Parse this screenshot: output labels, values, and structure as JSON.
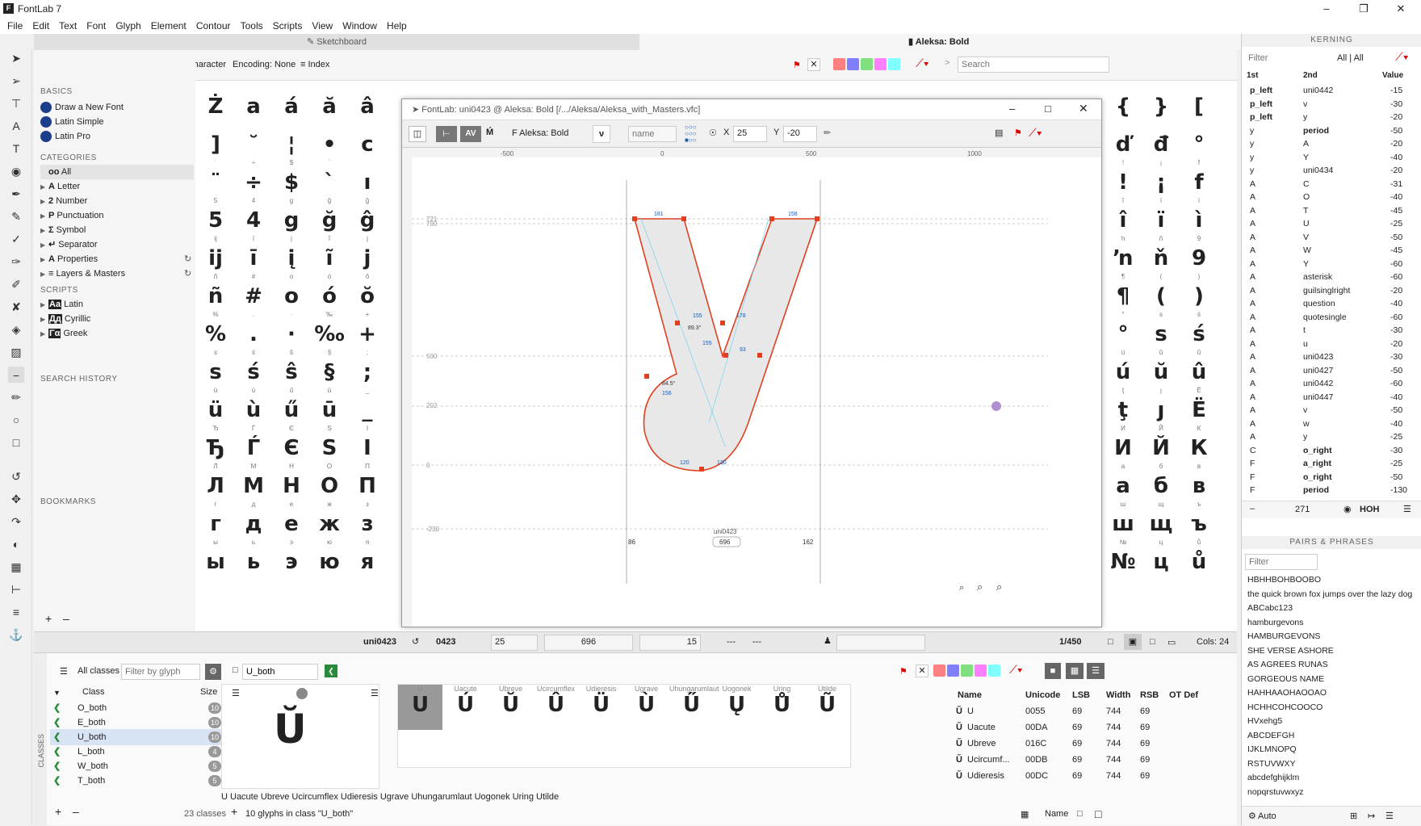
{
  "app": {
    "title": "FontLab 7"
  },
  "menu": [
    "File",
    "Edit",
    "Text",
    "Font",
    "Glyph",
    "Element",
    "Contour",
    "Tools",
    "Scripts",
    "View",
    "Window",
    "Help"
  ],
  "tabs": {
    "sketchboard": "Sketchboard",
    "font": "Aleksa: Bold"
  },
  "toolbar": {
    "character": "Character",
    "encoding": "Encoding: None",
    "index": "Index",
    "search_placeholder": "Search"
  },
  "sidebar": {
    "basics_title": "BASICS",
    "basics": [
      "Draw a New Font",
      "Latin Simple",
      "Latin Pro"
    ],
    "categories_title": "CATEGORIES",
    "categories": [
      "All",
      "Letter",
      "Number",
      "Punctuation",
      "Symbol",
      "Separator",
      "Properties",
      "Layers & Masters"
    ],
    "category_icons": [
      "oo",
      "A",
      "2",
      "P",
      "Σ",
      "↵",
      "A",
      "≡"
    ],
    "scripts_title": "SCRIPTS",
    "scripts": [
      "Latin",
      "Cyrillic",
      "Greek"
    ],
    "script_icons": [
      "Aa",
      "Дд",
      "Γα"
    ],
    "search_history_title": "SEARCH HISTORY",
    "bookmarks_title": "BOOKMARKS"
  },
  "grid_left": [
    [
      [
        "",
        "Ż"
      ],
      [
        "",
        "a"
      ],
      [
        "",
        "á"
      ],
      [
        "",
        "ă"
      ],
      [
        "",
        "â"
      ]
    ],
    [
      [
        "",
        "]"
      ],
      [
        "",
        "˘"
      ],
      [
        "",
        "¦"
      ],
      [
        "",
        "•"
      ],
      [
        "",
        "c"
      ]
    ],
    [
      [
        "˙",
        "¨"
      ],
      [
        "÷",
        "÷"
      ],
      [
        "$",
        "$"
      ],
      [
        "`",
        "`"
      ],
      [
        "",
        "ı"
      ]
    ],
    [
      [
        "5",
        "5"
      ],
      [
        "4",
        "4"
      ],
      [
        "g",
        "g"
      ],
      [
        "ğ",
        "ğ"
      ],
      [
        "ĝ",
        "ĝ"
      ]
    ],
    [
      [
        "ij",
        "ij"
      ],
      [
        "ī",
        "ī"
      ],
      [
        "į",
        "į"
      ],
      [
        "ĩ",
        "ĩ"
      ],
      [
        "j",
        "j"
      ]
    ],
    [
      [
        "ñ",
        "ñ"
      ],
      [
        "#",
        "#"
      ],
      [
        "o",
        "o"
      ],
      [
        "ó",
        "ó"
      ],
      [
        "ŏ",
        "ŏ"
      ]
    ],
    [
      [
        "%",
        "%"
      ],
      [
        ".",
        "."
      ],
      [
        "·",
        "·"
      ],
      [
        "‰",
        "‰"
      ],
      [
        "+",
        "+"
      ]
    ],
    [
      [
        "s",
        "s"
      ],
      [
        "ś",
        "ś"
      ],
      [
        "ŝ",
        "ŝ"
      ],
      [
        "§",
        "§"
      ],
      [
        ";",
        ";"
      ]
    ],
    [
      [
        "ü",
        "ü"
      ],
      [
        "ù",
        "ù"
      ],
      [
        "ű",
        "ű"
      ],
      [
        "ū",
        "ū"
      ],
      [
        "_",
        "_"
      ]
    ],
    [
      [
        "Ђ",
        "Ђ"
      ],
      [
        "Ѓ",
        "Ѓ"
      ],
      [
        "Є",
        "Є"
      ],
      [
        "Ѕ",
        "Ѕ"
      ],
      [
        "І",
        "І"
      ]
    ],
    [
      [
        "Л",
        "Л"
      ],
      [
        "М",
        "М"
      ],
      [
        "Н",
        "Н"
      ],
      [
        "О",
        "О"
      ],
      [
        "П",
        "П"
      ]
    ],
    [
      [
        "г",
        "г"
      ],
      [
        "д",
        "д"
      ],
      [
        "е",
        "е"
      ],
      [
        "ж",
        "ж"
      ],
      [
        "з",
        "з"
      ]
    ],
    [
      [
        "ы",
        "ы"
      ],
      [
        "ь",
        "ь"
      ],
      [
        "э",
        "э"
      ],
      [
        "ю",
        "ю"
      ],
      [
        "я",
        "я"
      ]
    ]
  ],
  "grid_right": [
    [
      [
        "",
        "{"
      ],
      [
        "",
        "}"
      ],
      [
        "",
        "["
      ]
    ],
    [
      [
        "",
        "ď"
      ],
      [
        "",
        "đ"
      ],
      [
        "",
        "°"
      ]
    ],
    [
      [
        "!",
        "!"
      ],
      [
        "¡",
        "¡"
      ],
      [
        "f",
        "f"
      ]
    ],
    [
      [
        "î",
        "î"
      ],
      [
        "ï",
        "ï"
      ],
      [
        "ì",
        "ì"
      ]
    ],
    [
      [
        "ŉ",
        "ŉ"
      ],
      [
        "ň",
        "ň"
      ],
      [
        "9",
        "9"
      ]
    ],
    [
      [
        "¶",
        "¶"
      ],
      [
        "(",
        "("
      ],
      [
        ")",
        ")"
      ]
    ],
    [
      [
        "°",
        "°"
      ],
      [
        "s",
        "s"
      ],
      [
        "ś",
        "ś"
      ]
    ],
    [
      [
        "ú",
        "ú"
      ],
      [
        "ŭ",
        "ŭ"
      ],
      [
        "û",
        "û"
      ]
    ],
    [
      [
        "ţ",
        "ţ"
      ],
      [
        "ȷ",
        "ȷ"
      ],
      [
        "Ë",
        "Ë"
      ]
    ],
    [
      [
        "И",
        "И"
      ],
      [
        "Й",
        "Й"
      ],
      [
        "К",
        "К"
      ]
    ],
    [
      [
        "а",
        "а"
      ],
      [
        "б",
        "б"
      ],
      [
        "в",
        "в"
      ]
    ],
    [
      [
        "ш",
        "ш"
      ],
      [
        "щ",
        "щ"
      ],
      [
        "ъ",
        "ъ"
      ]
    ],
    [
      [
        "№",
        "№"
      ],
      [
        "ц",
        "ц"
      ],
      [
        "ů",
        "ů"
      ]
    ]
  ],
  "glyph_window": {
    "title": "FontLab: uni0423 @ Aleksa: Bold [/.../Aleksa/Aleksa_with_Masters.vfc]",
    "font_label": "F Aleksa: Bold",
    "glyph_char": "ν",
    "name_placeholder": "name",
    "x_label": "X",
    "x_value": "25",
    "y_label": "Y",
    "y_value": "-20",
    "ruler": [
      "-500",
      "0",
      "500",
      "1000"
    ],
    "metrics": [
      "721",
      "700",
      "500",
      "202",
      "0",
      "-230"
    ],
    "glyph_name": "uni0423",
    "lsb": "86",
    "width": "696",
    "rsb": "162",
    "dims": [
      "181",
      "158",
      "155",
      "178",
      "155",
      "93",
      "156",
      "120",
      "130",
      "89.3°",
      "84.5°"
    ]
  },
  "status": {
    "name": "uni0423",
    "code": "0423",
    "lsb": "25",
    "width": "696",
    "rsb": "15",
    "dash1": "---",
    "dash2": "---",
    "count": "1/450",
    "cols": "Cols: 24"
  },
  "kerning": {
    "title": "KERNING",
    "filter_placeholder": "Filter",
    "all_label": "All | All",
    "headers": [
      "1st",
      "2nd",
      "Value"
    ],
    "rows": [
      [
        "p_left",
        "uni0442",
        "-15"
      ],
      [
        "p_left",
        "v",
        "-30"
      ],
      [
        "p_left",
        "y",
        "-20"
      ],
      [
        "y",
        "period",
        "-50"
      ],
      [
        "y",
        "A",
        "-20"
      ],
      [
        "y",
        "Y",
        "-40"
      ],
      [
        "y",
        "uni0434",
        "-20"
      ],
      [
        "A",
        "C",
        "-31"
      ],
      [
        "A",
        "O",
        "-40"
      ],
      [
        "A",
        "T",
        "-45"
      ],
      [
        "A",
        "U",
        "-25"
      ],
      [
        "A",
        "V",
        "-50"
      ],
      [
        "A",
        "W",
        "-45"
      ],
      [
        "A",
        "Y",
        "-60"
      ],
      [
        "A",
        "asterisk",
        "-60"
      ],
      [
        "A",
        "guilsinglright",
        "-20"
      ],
      [
        "A",
        "question",
        "-40"
      ],
      [
        "A",
        "quotesingle",
        "-60"
      ],
      [
        "A",
        "t",
        "-30"
      ],
      [
        "A",
        "u",
        "-20"
      ],
      [
        "A",
        "uni0423",
        "-30"
      ],
      [
        "A",
        "uni0427",
        "-50"
      ],
      [
        "A",
        "uni0442",
        "-60"
      ],
      [
        "A",
        "uni0447",
        "-40"
      ],
      [
        "A",
        "v",
        "-50"
      ],
      [
        "A",
        "w",
        "-40"
      ],
      [
        "A",
        "y",
        "-25"
      ],
      [
        "C",
        "o_right",
        "-30"
      ],
      [
        "F",
        "a_right",
        "-25"
      ],
      [
        "F",
        "o_right",
        "-50"
      ],
      [
        "F",
        "period",
        "-130"
      ]
    ],
    "count": "271",
    "preview": "HOH"
  },
  "pairs": {
    "title": "PAIRS & PHRASES",
    "filter_placeholder": "Filter",
    "items": [
      "HBHHBOHBOOBO",
      "the quick brown fox jumps over the lazy dog",
      "ABCabc123",
      "hamburgevons",
      "HAMBURGEVONS",
      "SHE VERSE ASHORE",
      "AS AGREES RUNAS",
      "GORGEOUS NAME",
      "HAHHAAOHAOOAO",
      "HCHHCOHCOOCO",
      "HVxehg5",
      "ABCDEFGH",
      "IJKLMNOPQ",
      "RSTUVWXY",
      "abcdefghijklm",
      "nopqrstuvwxyz"
    ],
    "auto": "Auto"
  },
  "classes": {
    "all_classes": "All classes",
    "filter_placeholder": "Filter by glyph",
    "current": "U_both",
    "header_class": "Class",
    "header_size": "Size",
    "rows": [
      [
        "O_both",
        "10"
      ],
      [
        "E_both",
        "10"
      ],
      [
        "U_both",
        "10"
      ],
      [
        "L_both",
        "4"
      ],
      [
        "W_both",
        "5"
      ],
      [
        "T_both",
        "5"
      ]
    ],
    "count_label": "23 classes",
    "glyphs_info": "10 glyphs in class \"U_both\"",
    "sequence": "U Uacute Ubreve Ucircumflex Udieresis Ugrave Uhungarumlaut Uogonek Uring Utilde",
    "glyph_row": [
      [
        "U",
        "U"
      ],
      [
        "Uacute",
        "Ú"
      ],
      [
        "Ubreve",
        "Ŭ"
      ],
      [
        "Ucircumflex",
        "Û"
      ],
      [
        "Udieresis",
        "Ü"
      ],
      [
        "Ugrave",
        "Ù"
      ],
      [
        "Uhungarumlaut",
        "Ű"
      ],
      [
        "Uogonek",
        "Ų"
      ],
      [
        "Uring",
        "Ů"
      ],
      [
        "Utilde",
        "Ũ"
      ]
    ],
    "preview_glyph": "Ŭ",
    "table_headers": [
      "Name",
      "Unicode",
      "LSB",
      "Width",
      "RSB",
      "OT Def"
    ],
    "table_rows": [
      [
        "U",
        "0055",
        "69",
        "744",
        "69"
      ],
      [
        "Uacute",
        "00DA",
        "69",
        "744",
        "69"
      ],
      [
        "Ubreve",
        "016C",
        "69",
        "744",
        "69"
      ],
      [
        "Ucircumf...",
        "00DB",
        "69",
        "744",
        "69"
      ],
      [
        "Udieresis",
        "00DC",
        "69",
        "744",
        "69"
      ]
    ],
    "name_label": "Name"
  },
  "colors": {
    "red": "#ff8080",
    "blue": "#8080ff",
    "green": "#80e080",
    "pink": "#ff80ff",
    "cyan": "#80ffff",
    "accent": "#e04020"
  }
}
